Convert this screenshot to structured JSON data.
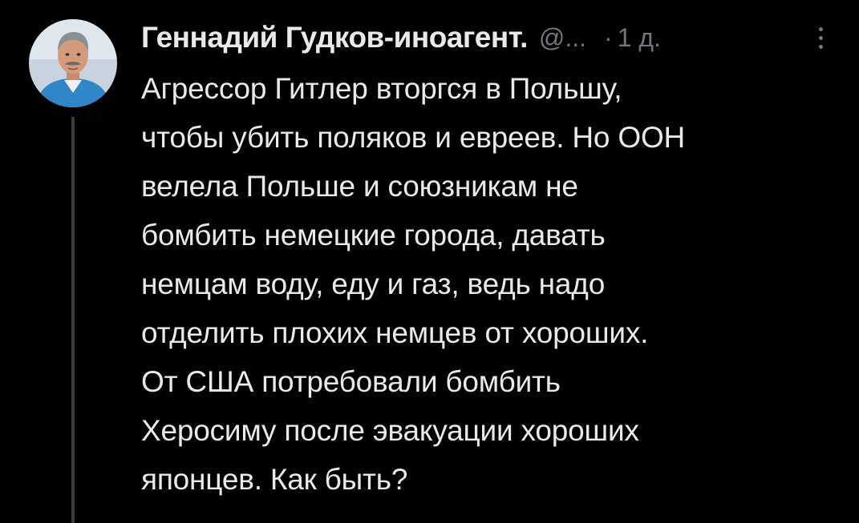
{
  "tweet": {
    "author": {
      "display_name": "Геннадий Гудков-иноагент.",
      "handle": "@...",
      "avatar_icon": "avatar-photo-icon"
    },
    "separator": "·",
    "timestamp": "1 д.",
    "more_icon": "more-vertical-icon",
    "text_lines": [
      "Агрессор Гитлер вторгся в Польшу,",
      "чтобы убить поляков и евреев. Но ООН",
      "велела Польше и союзникам не",
      "бомбить немецкие города, давать",
      "немцам воду, еду и газ, ведь надо",
      "отделить плохих немцев от хороших.",
      "От США потребовали бомбить",
      "Херосиму после эвакуации хороших",
      "японцев. Как быть?"
    ]
  },
  "colors": {
    "background": "#000000",
    "primary_text": "#e7e9ea",
    "secondary_text": "#71767b",
    "thread_line": "#3a3d40"
  }
}
